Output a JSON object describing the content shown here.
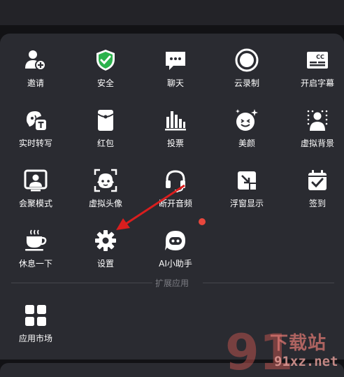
{
  "apps": [
    {
      "key": "invite",
      "label": "邀请",
      "icon": "person-add-icon"
    },
    {
      "key": "security",
      "label": "安全",
      "icon": "shield-check-icon"
    },
    {
      "key": "chat",
      "label": "聊天",
      "icon": "chat-bubble-icon"
    },
    {
      "key": "cloud_record",
      "label": "云录制",
      "icon": "record-icon"
    },
    {
      "key": "captions",
      "label": "开启字幕",
      "icon": "cc-icon"
    },
    {
      "key": "transcribe",
      "label": "实时转写",
      "icon": "voice-transcribe-icon"
    },
    {
      "key": "red_packet",
      "label": "红包",
      "icon": "red-packet-icon"
    },
    {
      "key": "vote",
      "label": "投票",
      "icon": "bar-chart-icon"
    },
    {
      "key": "beauty",
      "label": "美颜",
      "icon": "smile-sparkle-icon"
    },
    {
      "key": "virtual_bg",
      "label": "虚拟背景",
      "icon": "virtual-background-icon"
    },
    {
      "key": "focus_mode",
      "label": "会聚模式",
      "icon": "focus-mode-icon"
    },
    {
      "key": "avatar",
      "label": "虚拟头像",
      "icon": "virtual-avatar-icon"
    },
    {
      "key": "disconnect_audio",
      "label": "断开音频",
      "icon": "headset-icon"
    },
    {
      "key": "float_window",
      "label": "浮窗显示",
      "icon": "float-window-icon"
    },
    {
      "key": "checkin",
      "label": "签到",
      "icon": "calendar-check-icon"
    },
    {
      "key": "break",
      "label": "休息一下",
      "icon": "coffee-cup-icon"
    },
    {
      "key": "settings",
      "label": "设置",
      "icon": "gear-icon"
    },
    {
      "key": "ai_assistant",
      "label": "AI小助手",
      "icon": "ai-robot-icon"
    }
  ],
  "extension": {
    "divider_label": "扩展应用",
    "app_store": {
      "label": "应用市场",
      "icon": "grid-apps-icon"
    }
  },
  "badge": {
    "ai_assistant_color": "#e8473d"
  },
  "annotation": {
    "arrow_color": "#d91e1e"
  },
  "watermark": {
    "line1": "下载站",
    "line2": "91xz.net"
  },
  "colors": {
    "panel": "#2a2b31",
    "background": "#121215",
    "text": "#ffffff",
    "security_green": "#2bb24c"
  }
}
